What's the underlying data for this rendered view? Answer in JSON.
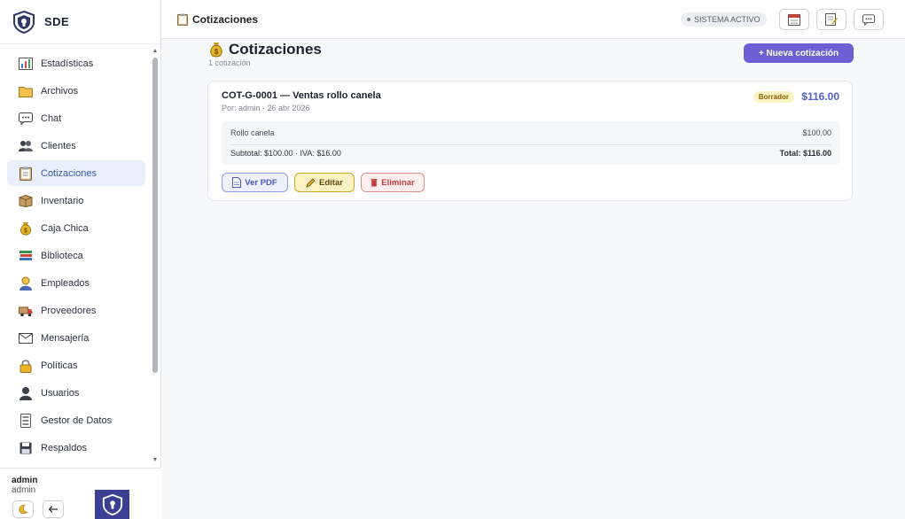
{
  "app": {
    "brand": "SDE"
  },
  "sidebar": {
    "items": [
      {
        "label": "Estadísticas",
        "icon": "bar-chart-icon"
      },
      {
        "label": "Archivos",
        "icon": "folder-icon"
      },
      {
        "label": "Chat",
        "icon": "chat-icon"
      },
      {
        "label": "Clientes",
        "icon": "clients-icon"
      },
      {
        "label": "Cotizaciones",
        "icon": "clipboard-icon",
        "active": true
      },
      {
        "label": "Inventario",
        "icon": "box-icon"
      },
      {
        "label": "Caja Chica",
        "icon": "money-bag-icon"
      },
      {
        "label": "Biblioteca",
        "icon": "books-icon"
      },
      {
        "label": "Empleados",
        "icon": "employee-icon"
      },
      {
        "label": "Proveedores",
        "icon": "truck-icon"
      },
      {
        "label": "Mensajería",
        "icon": "envelope-icon"
      },
      {
        "label": "Políticas",
        "icon": "lock-icon"
      },
      {
        "label": "Usuarios",
        "icon": "user-icon"
      },
      {
        "label": "Gestor de Datos",
        "icon": "database-icon"
      },
      {
        "label": "Respaldos",
        "icon": "floppy-icon"
      }
    ],
    "user": {
      "name": "admin",
      "role": "admin"
    }
  },
  "topbar": {
    "title": "Cotizaciones",
    "status": "SISTEMA ACTIVO"
  },
  "main": {
    "title": "Cotizaciones",
    "subtitle": "1 cotización",
    "new_button": "+ Nueva cotización",
    "quotes": [
      {
        "code_title": "COT-G-0001 — Ventas rollo canela",
        "meta": "Por: admin · 26 abr 2026",
        "status": "Borrador",
        "total": "$116.00",
        "line_item": {
          "name": "Rollo canela",
          "amount": "$100.00"
        },
        "summary": "Subtotal: $100.00 · IVA: $16.00",
        "summary_total": "Total: $116.00",
        "actions": {
          "pdf": "Ver PDF",
          "edit": "Editar",
          "delete": "Eliminar"
        }
      }
    ]
  },
  "colors": {
    "accent": "#6c60d4",
    "active_bg": "#e8effb",
    "total": "#4f5fc4"
  }
}
